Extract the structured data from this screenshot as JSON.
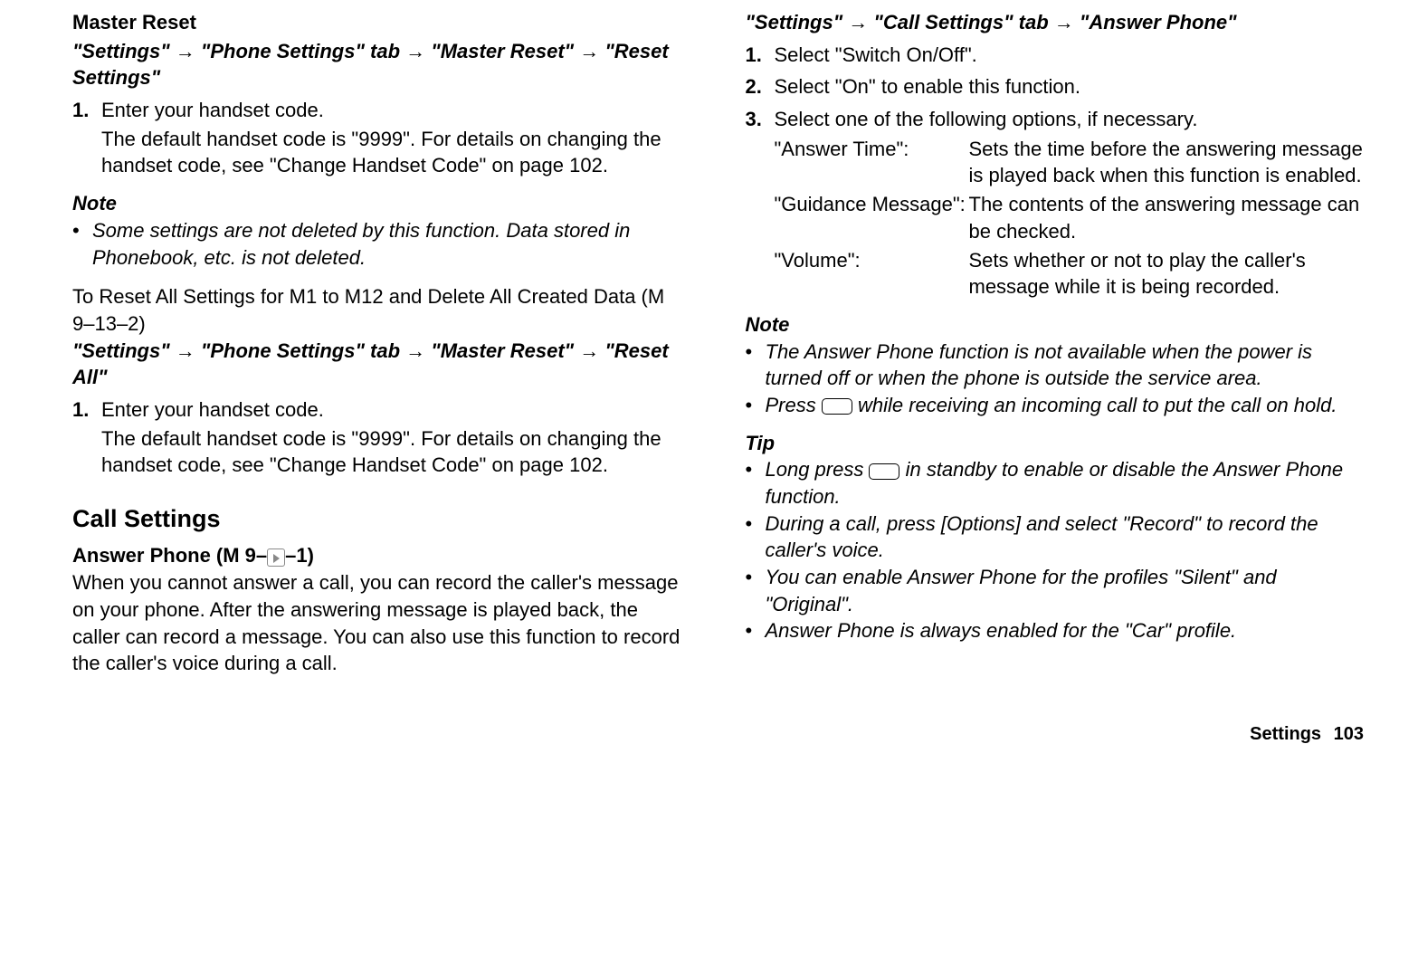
{
  "left": {
    "master_reset_title": "Master Reset",
    "path1_seg1": "\"Settings\"",
    "path1_seg2": "\"Phone Settings\" tab",
    "path1_seg3": "\"Master Reset\"",
    "path1_seg4": "\"Reset Settings\"",
    "step1_num": "1.",
    "step1_text": "Enter your handset code.",
    "step1_desc": "The default handset code is \"9999\". For details on changing the handset code, see \"Change Handset Code\" on page 102.",
    "note_heading": "Note",
    "note1_text": "Some settings are not deleted by this function. Data stored in Phonebook, etc. is not deleted.",
    "reset_all_title": "To Reset All Settings for M1 to M12 and Delete All Created Data (M 9–13–2)",
    "path2_seg1": "\"Settings\"",
    "path2_seg2": "\"Phone Settings\" tab",
    "path2_seg3": "\"Master Reset\"",
    "path2_seg4": "\"Reset All\"",
    "step2_num": "1.",
    "step2_text": "Enter your handset code.",
    "step2_desc": "The default handset code is \"9999\". For details on changing the handset code, see \"Change Handset Code\" on page 102.",
    "call_settings_title": "Call Settings",
    "answer_phone_label_pre": "Answer Phone (M 9–",
    "answer_phone_label_post": "–1)",
    "answer_phone_body": "When you cannot answer a call, you can record the caller's message on your phone. After the answering message is played back, the caller can record a message. You can also use this function to record the caller's voice during a call."
  },
  "right": {
    "path3_seg1": "\"Settings\"",
    "path3_seg2": "\"Call Settings\" tab",
    "path3_seg3": "\"Answer Phone\"",
    "rs1_num": "1.",
    "rs1_text": "Select \"Switch On/Off\".",
    "rs2_num": "2.",
    "rs2_text": "Select \"On\" to enable this function.",
    "rs3_num": "3.",
    "rs3_text": "Select one of the following options, if necessary.",
    "opt1_label": "\"Answer Time\":",
    "opt1_desc": "Sets the time before the answering message is played back when this function is enabled.",
    "opt2_label": "\"Guidance Message\":",
    "opt2_desc": "The contents of the answering message can be checked.",
    "opt3_label": "\"Volume\":",
    "opt3_desc": "Sets whether or not to play the caller's message while it is being recorded.",
    "note_heading": "Note",
    "rnote1": "The Answer Phone function is not available when the power is turned off or when the phone is outside the service area.",
    "rnote2_pre": "Press ",
    "rnote2_post": " while receiving an incoming call to put the call on hold.",
    "tip_heading": "Tip",
    "tip1_pre": "Long press ",
    "tip1_post": " in standby to enable or disable the Answer Phone function.",
    "tip2": "During a call, press [Options] and select \"Record\" to record the caller's voice.",
    "tip3": "You can enable Answer Phone for the profiles \"Silent\" and \"Original\".",
    "tip4": "Answer Phone is always enabled for the \"Car\" profile."
  },
  "footer": {
    "label": "Settings",
    "page": "103"
  },
  "bullet": "•",
  "arrow": "→"
}
